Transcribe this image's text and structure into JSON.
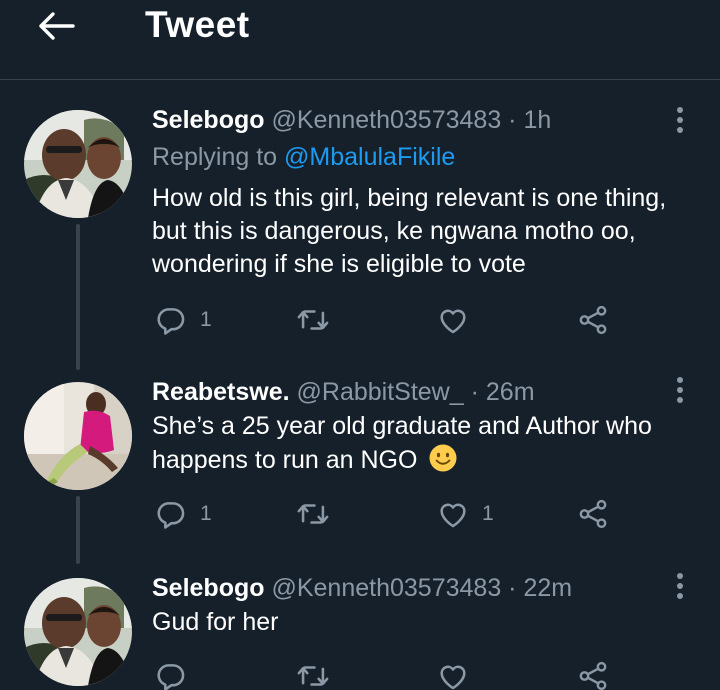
{
  "header": {
    "title": "Tweet",
    "back_icon": "back-arrow-icon"
  },
  "colors": {
    "background": "#15202b",
    "muted": "#8b98a5",
    "link": "#1d9bf0",
    "divider": "#38444d"
  },
  "tweets": [
    {
      "name": "Selebogo",
      "handle": "@Kenneth03573483",
      "dot": "·",
      "time": "1h",
      "replying_prefix": "Replying to",
      "replying_to": "@MbalulaFikile",
      "lines": [
        "How old is this girl, being relevant is one thing,",
        "but this is dangerous, ke ngwana motho oo,",
        "wondering if she is eligible to vote"
      ],
      "reply_count": "1",
      "retweet_count": "",
      "like_count": ""
    },
    {
      "name": "Reabetswe.",
      "handle": "@RabbitStew_",
      "dot": "·",
      "time": "26m",
      "lines": [
        "She’s a 25 year old graduate and Author who",
        "happens to run an NGO"
      ],
      "emoji": "slightly-smiling-face-emoji",
      "reply_count": "1",
      "retweet_count": "",
      "like_count": "1"
    },
    {
      "name": "Selebogo",
      "handle": "@Kenneth03573483",
      "dot": "·",
      "time": "22m",
      "lines": [
        "Gud for her"
      ],
      "reply_count": "",
      "retweet_count": "",
      "like_count": ""
    }
  ]
}
